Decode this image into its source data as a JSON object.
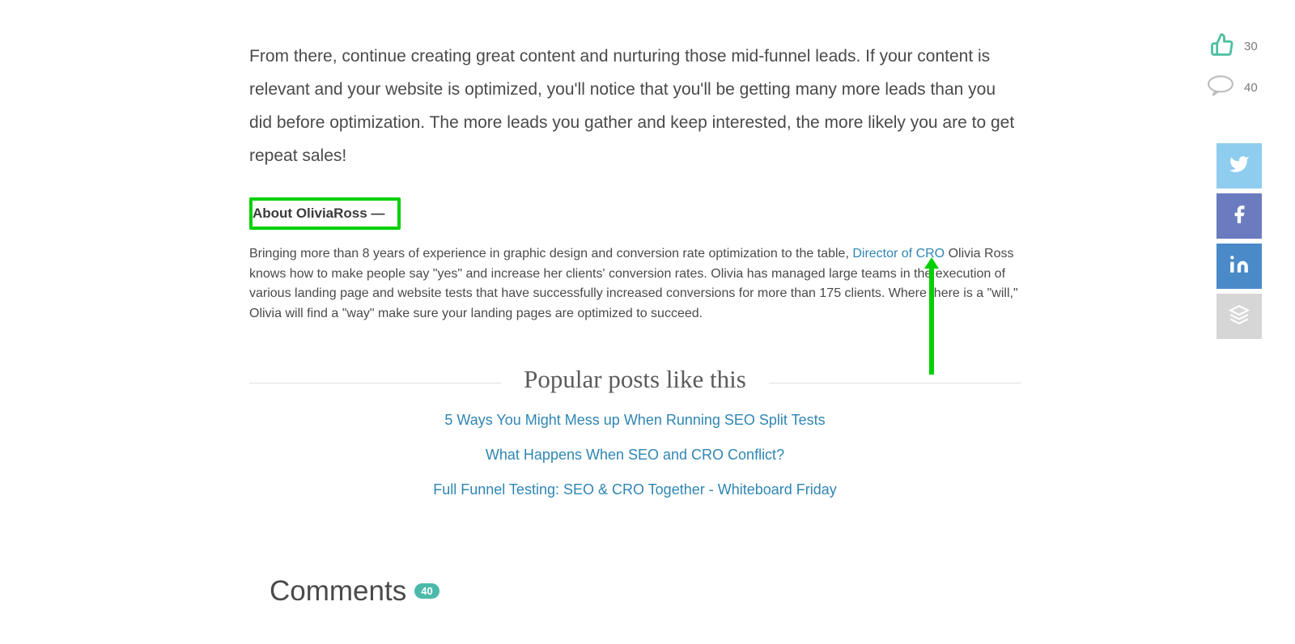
{
  "article": {
    "closing_para": "From there, continue creating great content and nurturing those mid-funnel leads. If your content is relevant and your website is optimized, you'll notice that you'll be getting many more leads than you did before optimization. The more leads you gather and keep interested, the more likely you are to get repeat sales!"
  },
  "author": {
    "heading": "About OliviaRoss —",
    "bio_before": "Bringing more than 8 years of experience in graphic design and conversion rate optimization to the table, ",
    "bio_link": "Director of CRO",
    "bio_after": " Olivia Ross knows how to make people say \"yes\" and increase her clients' conversion rates. Olivia has managed large teams in the execution of various landing page and website tests that have successfully increased conversions for more than 175 clients. Where there is a \"will,\" Olivia will find a \"way\" make sure your landing pages are optimized to succeed."
  },
  "popular": {
    "heading": "Popular posts like this",
    "links": [
      "5 Ways You Might Mess up When Running SEO Split Tests",
      "What Happens When SEO and CRO Conflict?",
      "Full Funnel Testing: SEO & CRO Together - Whiteboard Friday"
    ]
  },
  "comments": {
    "heading": "Comments",
    "count": "40"
  },
  "sidebar": {
    "likes": "30",
    "comments": "40"
  }
}
